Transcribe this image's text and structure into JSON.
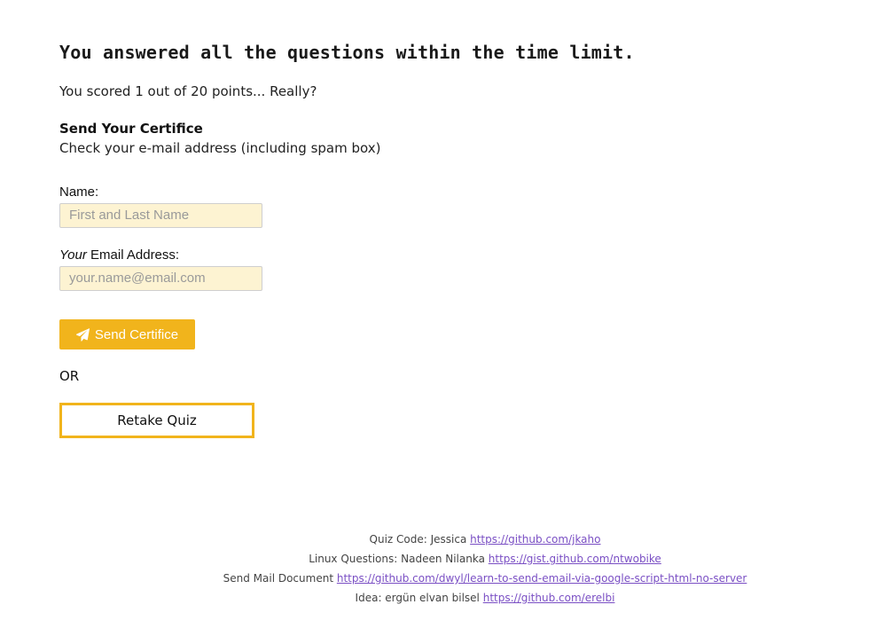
{
  "result": {
    "title": "You answered all the questions within the time limit.",
    "score_text": "You scored 1 out of 20 points... Really?"
  },
  "certificate": {
    "heading": "Send Your Certifice",
    "subtext": "Check your e-mail address (including spam box)",
    "name_label": "Name:",
    "name_placeholder": "First and Last Name",
    "email_label_em": "Your",
    "email_label_rest": " Email Address:",
    "email_placeholder": "your.name@email.com",
    "send_button_label": "Send Certifice",
    "send_icon": "paper-plane-icon"
  },
  "or_text": "OR",
  "retake_button_label": "Retake Quiz",
  "credits": [
    {
      "prefix": "Quiz Code: Jessica ",
      "link": "https://github.com/jkaho"
    },
    {
      "prefix": "Linux Questions: Nadeen Nilanka ",
      "link": "https://gist.github.com/ntwobike"
    },
    {
      "prefix": "Send Mail Document ",
      "link": "https://github.com/dwyl/learn-to-send-email-via-google-script-html-no-server"
    },
    {
      "prefix": "Idea: ergün elvan bilsel ",
      "link": "https://github.com/erelbi"
    }
  ],
  "colors": {
    "accent": "#f1b41c",
    "input_bg": "#fdf3d2",
    "link": "#7a4fc4"
  }
}
